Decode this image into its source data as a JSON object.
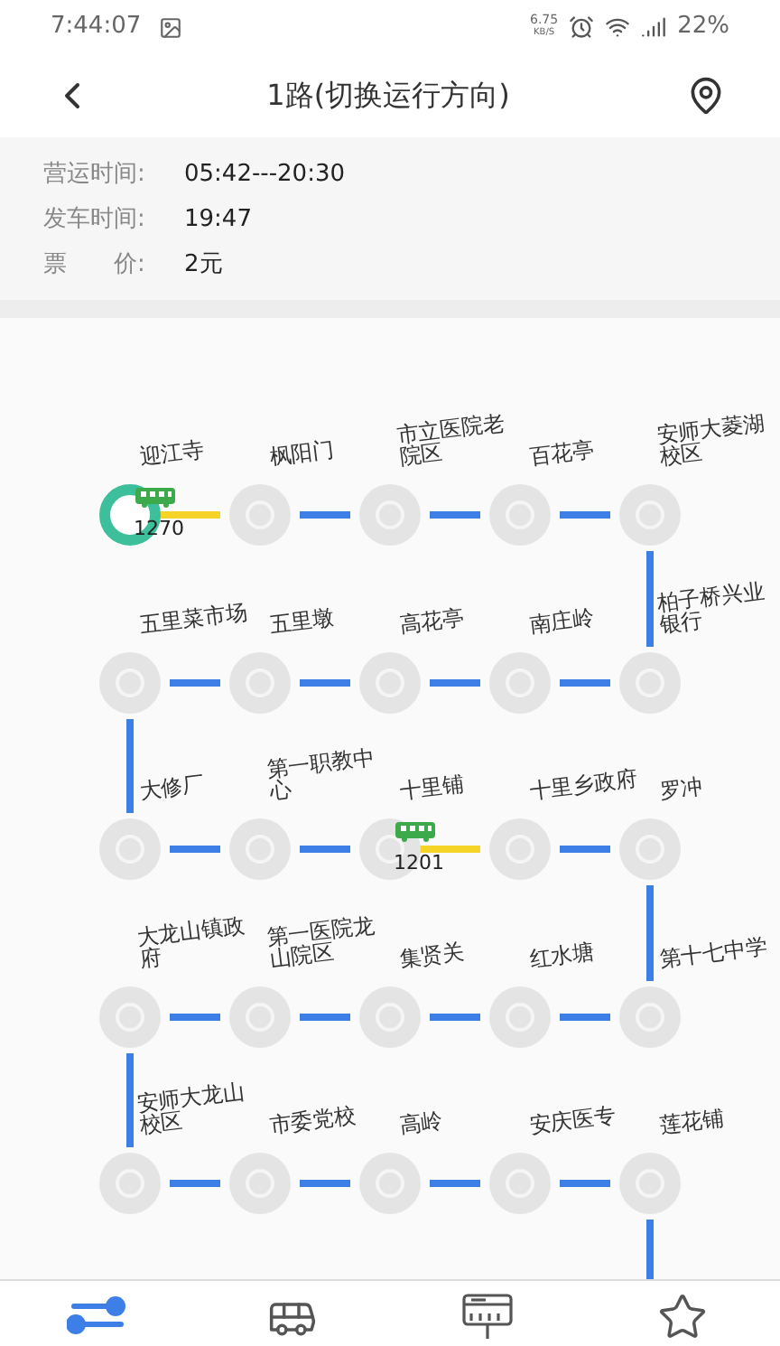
{
  "status_bar": {
    "time": "7:44:07",
    "speed": "6.75",
    "speed_unit": "KB/S",
    "battery": "22%"
  },
  "header": {
    "title": "1路(切换运行方向)"
  },
  "info": [
    {
      "label": "营运时间:",
      "value": "05:42---20:30"
    },
    {
      "label": "发车时间:",
      "value": "19:47"
    },
    {
      "label": "票　　价:",
      "value": "2元"
    }
  ],
  "stations": [
    {
      "name": "迎江寺",
      "selected": true,
      "bus": "1270"
    },
    {
      "name": "枫阳门",
      "selected": false
    },
    {
      "name": "市立医院老院区",
      "selected": false
    },
    {
      "name": "百花亭",
      "selected": false
    },
    {
      "name": "安师大菱湖校区",
      "selected": false
    },
    {
      "name": "柏子桥兴业银行",
      "selected": false
    },
    {
      "name": "南庄岭",
      "selected": false
    },
    {
      "name": "高花亭",
      "selected": false
    },
    {
      "name": "五里墩",
      "selected": false
    },
    {
      "name": "五里菜市场",
      "selected": false
    },
    {
      "name": "大修厂",
      "selected": false
    },
    {
      "name": "第一职教中心",
      "selected": false
    },
    {
      "name": "十里铺",
      "selected": false,
      "bus": "1201"
    },
    {
      "name": "十里乡政府",
      "selected": false
    },
    {
      "name": "罗冲",
      "selected": false
    },
    {
      "name": "第十七中学",
      "selected": false
    },
    {
      "name": "红水塘",
      "selected": false
    },
    {
      "name": "集贤关",
      "selected": false
    },
    {
      "name": "第一医院龙山院区",
      "selected": false
    },
    {
      "name": "大龙山镇政府",
      "selected": false
    },
    {
      "name": "安师大龙山校区",
      "selected": false
    },
    {
      "name": "市委党校",
      "selected": false
    },
    {
      "name": "高岭",
      "selected": false
    },
    {
      "name": "安庆医专",
      "selected": false
    },
    {
      "name": "莲花铺",
      "selected": false
    }
  ],
  "bottom_nav": [
    {
      "kind": "route",
      "selected": true
    },
    {
      "kind": "bus",
      "selected": false
    },
    {
      "kind": "stop",
      "selected": false
    },
    {
      "kind": "favorite",
      "selected": false
    }
  ]
}
